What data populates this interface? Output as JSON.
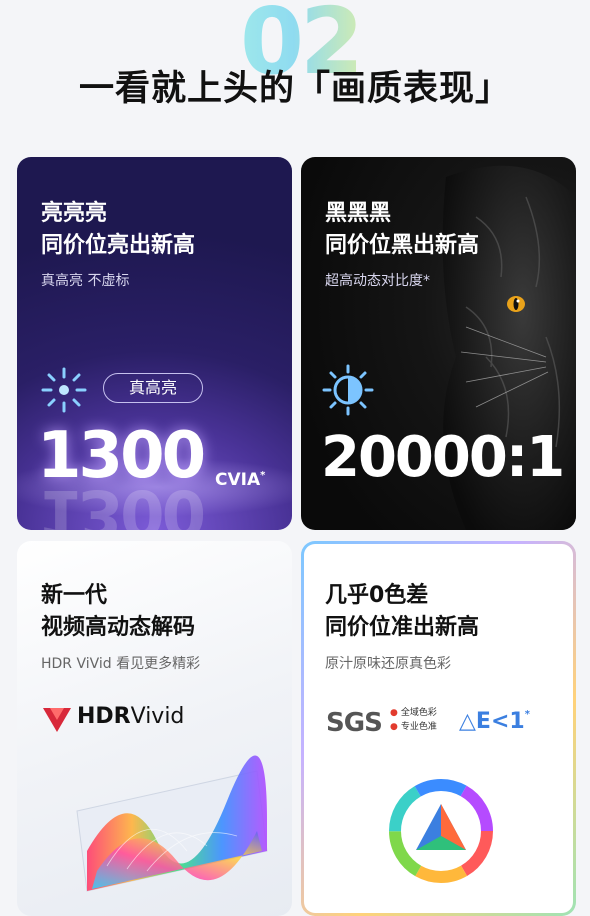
{
  "header": {
    "number": "02",
    "title": "一看就上头的「画质表现」"
  },
  "cards": [
    {
      "line1": "亮亮亮",
      "line2": "同价位亮出新高",
      "sub": "真高亮 不虚标",
      "pill": "真高亮",
      "value": "1300",
      "unit": "CVIA",
      "asterisk": "*"
    },
    {
      "line1": "黑黑黑",
      "line2": "同价位黑出新高",
      "sub": "超高动态对比度*",
      "value": "20000:1"
    },
    {
      "line1": "新一代",
      "line2": "视频高动态解码",
      "sub": "HDR ViVid 看见更多精彩",
      "logo_bold": "HDR",
      "logo_light": "Vivid"
    },
    {
      "line1": "几乎0色差",
      "line2": "同价位准出新高",
      "sub": "原汁原味还原真色彩",
      "sgs": "SGS",
      "sgs_line1": "全域色彩",
      "sgs_line2": "专业色准",
      "delta": "△E<1",
      "delta_ast": "*"
    }
  ],
  "colors": {
    "accent_purple": "#4a3398",
    "glow": "#7c5bd8",
    "blue": "#3b7fe0",
    "tiger_eye": "#e9a21a"
  },
  "icons": [
    "sun-icon",
    "contrast-icon",
    "hdr-vivid-logo-icon",
    "rainbow-ribbons-image",
    "tiger-image",
    "color-ring-icon"
  ]
}
